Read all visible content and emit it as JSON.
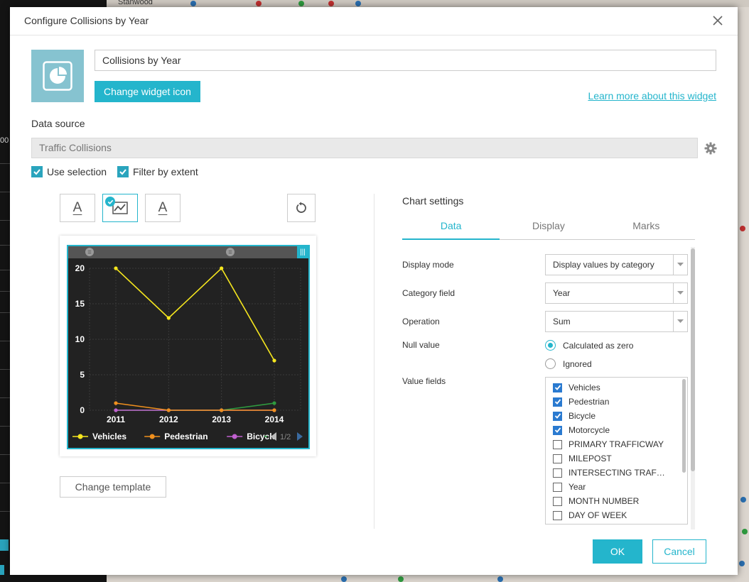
{
  "background": {
    "map_label": "Stanwood",
    "left_edge_text": "00"
  },
  "dialog": {
    "title": "Configure Collisions by Year",
    "widget_name": "Collisions by Year",
    "change_icon_label": "Change widget icon",
    "learn_more_label": "Learn more about this widget",
    "data_source_label": "Data source",
    "data_source_value": "Traffic Collisions",
    "use_selection_label": "Use selection",
    "use_selection_checked": true,
    "filter_extent_label": "Filter by extent",
    "filter_extent_checked": true,
    "change_template_label": "Change template",
    "ok_label": "OK",
    "cancel_label": "Cancel"
  },
  "colors": {
    "accent": "#24b5cc",
    "vehicles": "#f5e61e",
    "pedestrian": "#f0901e",
    "bicycle": "#c060d0",
    "motorcycle": "#2f9a3f"
  },
  "chart_data": {
    "type": "line",
    "categories": [
      "2011",
      "2012",
      "2013",
      "2014"
    ],
    "ylim": [
      0,
      20
    ],
    "yticks": [
      "0",
      "5",
      "10",
      "15",
      "20"
    ],
    "series": [
      {
        "name": "Vehicles",
        "values": [
          20,
          13,
          20,
          7
        ]
      },
      {
        "name": "Pedestrian",
        "values": [
          1,
          0,
          0,
          0
        ]
      },
      {
        "name": "Bicycle",
        "values": [
          0,
          0,
          0,
          0
        ]
      },
      {
        "name": "Motorcycle",
        "values": [
          0,
          0,
          0,
          1
        ]
      }
    ],
    "legend_visible": [
      "Vehicles",
      "Pedestrian",
      "Bicycle"
    ],
    "legend_page": "1/2",
    "grid": true,
    "legend_position": "bottom"
  },
  "chart_settings": {
    "title": "Chart settings",
    "tabs": [
      "Data",
      "Display",
      "Marks"
    ],
    "active_tab": "Data",
    "display_mode_label": "Display mode",
    "display_mode_value": "Display values by category",
    "category_field_label": "Category field",
    "category_field_value": "Year",
    "operation_label": "Operation",
    "operation_value": "Sum",
    "null_value_label": "Null value",
    "null_options": [
      "Calculated as zero",
      "Ignored"
    ],
    "null_selected": "Calculated as zero",
    "value_fields_label": "Value fields",
    "value_fields": [
      {
        "label": "Vehicles",
        "checked": true
      },
      {
        "label": "Pedestrian",
        "checked": true
      },
      {
        "label": "Bicycle",
        "checked": true
      },
      {
        "label": "Motorcycle",
        "checked": true
      },
      {
        "label": "PRIMARY TRAFFICWAY",
        "checked": false
      },
      {
        "label": "MILEPOST",
        "checked": false
      },
      {
        "label": "INTERSECTING TRAF…",
        "checked": false
      },
      {
        "label": "Year",
        "checked": false
      },
      {
        "label": "MONTH NUMBER",
        "checked": false
      },
      {
        "label": "DAY OF WEEK",
        "checked": false
      }
    ]
  }
}
